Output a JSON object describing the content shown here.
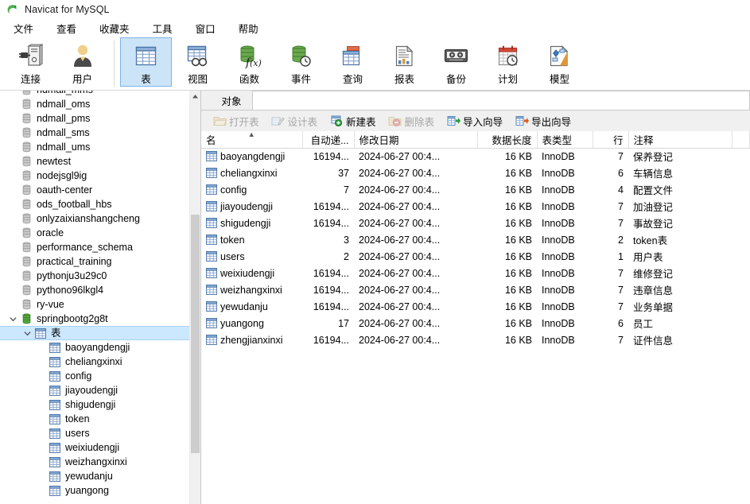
{
  "window": {
    "title": "Navicat for MySQL",
    "logo_icon": "navicat-logo-icon"
  },
  "menubar": {
    "items": [
      {
        "label": "文件",
        "name": "menu-file"
      },
      {
        "label": "查看",
        "name": "menu-view"
      },
      {
        "label": "收藏夹",
        "name": "menu-favorites"
      },
      {
        "label": "工具",
        "name": "menu-tools"
      },
      {
        "label": "窗口",
        "name": "menu-window"
      },
      {
        "label": "帮助",
        "name": "menu-help"
      }
    ]
  },
  "toolbar": {
    "buttons": [
      {
        "label": "连接",
        "icon": "connection-icon",
        "selected": false
      },
      {
        "label": "用户",
        "icon": "user-icon",
        "selected": false
      },
      {
        "label": "表",
        "icon": "table-icon",
        "selected": true
      },
      {
        "label": "视图",
        "icon": "view-icon",
        "selected": false
      },
      {
        "label": "函数",
        "icon": "function-icon",
        "selected": false
      },
      {
        "label": "事件",
        "icon": "event-icon",
        "selected": false
      },
      {
        "label": "查询",
        "icon": "query-icon",
        "selected": false
      },
      {
        "label": "报表",
        "icon": "report-icon",
        "selected": false
      },
      {
        "label": "备份",
        "icon": "backup-icon",
        "selected": false
      },
      {
        "label": "计划",
        "icon": "schedule-icon",
        "selected": false
      },
      {
        "label": "模型",
        "icon": "model-icon",
        "selected": false
      }
    ]
  },
  "sidebar": {
    "nodes": [
      {
        "label": "ndmall_mms",
        "icon": "database-icon",
        "indent": 1,
        "twist": "",
        "selected": false
      },
      {
        "label": "ndmall_oms",
        "icon": "database-icon",
        "indent": 1,
        "twist": "",
        "selected": false
      },
      {
        "label": "ndmall_pms",
        "icon": "database-icon",
        "indent": 1,
        "twist": "",
        "selected": false
      },
      {
        "label": "ndmall_sms",
        "icon": "database-icon",
        "indent": 1,
        "twist": "",
        "selected": false
      },
      {
        "label": "ndmall_ums",
        "icon": "database-icon",
        "indent": 1,
        "twist": "",
        "selected": false
      },
      {
        "label": "newtest",
        "icon": "database-icon",
        "indent": 1,
        "twist": "",
        "selected": false
      },
      {
        "label": "nodejsgl9ig",
        "icon": "database-icon",
        "indent": 1,
        "twist": "",
        "selected": false
      },
      {
        "label": "oauth-center",
        "icon": "database-icon",
        "indent": 1,
        "twist": "",
        "selected": false
      },
      {
        "label": "ods_football_hbs",
        "icon": "database-icon",
        "indent": 1,
        "twist": "",
        "selected": false
      },
      {
        "label": "onlyzaixianshangcheng",
        "icon": "database-icon",
        "indent": 1,
        "twist": "",
        "selected": false
      },
      {
        "label": "oracle",
        "icon": "database-icon",
        "indent": 1,
        "twist": "",
        "selected": false
      },
      {
        "label": "performance_schema",
        "icon": "database-icon",
        "indent": 1,
        "twist": "",
        "selected": false
      },
      {
        "label": "practical_training",
        "icon": "database-icon",
        "indent": 1,
        "twist": "",
        "selected": false
      },
      {
        "label": "pythonju3u29c0",
        "icon": "database-icon",
        "indent": 1,
        "twist": "",
        "selected": false
      },
      {
        "label": "pythono96lkgl4",
        "icon": "database-icon",
        "indent": 1,
        "twist": "",
        "selected": false
      },
      {
        "label": "ry-vue",
        "icon": "database-icon",
        "indent": 1,
        "twist": "",
        "selected": false
      },
      {
        "label": "springbootg2g8t",
        "icon": "database-open-icon",
        "indent": 1,
        "twist": "expanded",
        "selected": false
      },
      {
        "label": "表",
        "icon": "table-folder-icon",
        "indent": 2,
        "twist": "expanded",
        "selected": true
      },
      {
        "label": "baoyangdengji",
        "icon": "table-item-icon",
        "indent": 3,
        "twist": "",
        "selected": false
      },
      {
        "label": "cheliangxinxi",
        "icon": "table-item-icon",
        "indent": 3,
        "twist": "",
        "selected": false
      },
      {
        "label": "config",
        "icon": "table-item-icon",
        "indent": 3,
        "twist": "",
        "selected": false
      },
      {
        "label": "jiayoudengji",
        "icon": "table-item-icon",
        "indent": 3,
        "twist": "",
        "selected": false
      },
      {
        "label": "shigudengji",
        "icon": "table-item-icon",
        "indent": 3,
        "twist": "",
        "selected": false
      },
      {
        "label": "token",
        "icon": "table-item-icon",
        "indent": 3,
        "twist": "",
        "selected": false
      },
      {
        "label": "users",
        "icon": "table-item-icon",
        "indent": 3,
        "twist": "",
        "selected": false
      },
      {
        "label": "weixiudengji",
        "icon": "table-item-icon",
        "indent": 3,
        "twist": "",
        "selected": false
      },
      {
        "label": "weizhangxinxi",
        "icon": "table-item-icon",
        "indent": 3,
        "twist": "",
        "selected": false
      },
      {
        "label": "yewudanju",
        "icon": "table-item-icon",
        "indent": 3,
        "twist": "",
        "selected": false
      },
      {
        "label": "yuangong",
        "icon": "table-item-icon",
        "indent": 3,
        "twist": "",
        "selected": false
      }
    ]
  },
  "tabs": {
    "items": [
      {
        "label": "对象",
        "active": true
      }
    ]
  },
  "objectbar": {
    "buttons": [
      {
        "label": "打开表",
        "icon": "open-table-icon",
        "disabled": true
      },
      {
        "label": "设计表",
        "icon": "design-table-icon",
        "disabled": true
      },
      {
        "label": "新建表",
        "icon": "new-table-icon",
        "disabled": false
      },
      {
        "label": "删除表",
        "icon": "delete-table-icon",
        "disabled": true
      },
      {
        "label": "导入向导",
        "icon": "import-wizard-icon",
        "disabled": false
      },
      {
        "label": "导出向导",
        "icon": "export-wizard-icon",
        "disabled": false
      }
    ]
  },
  "grid": {
    "columns": [
      {
        "key": "name",
        "label": "名",
        "align": "left",
        "sorted": true
      },
      {
        "key": "autoinc",
        "label": "自动递...",
        "align": "right",
        "sorted": false
      },
      {
        "key": "modified",
        "label": "修改日期",
        "align": "left",
        "sorted": false
      },
      {
        "key": "length",
        "label": "数据长度",
        "align": "right",
        "sorted": false
      },
      {
        "key": "engine",
        "label": "表类型",
        "align": "left",
        "sorted": false
      },
      {
        "key": "rows",
        "label": "行",
        "align": "right",
        "sorted": false
      },
      {
        "key": "comment",
        "label": "注释",
        "align": "left",
        "sorted": false
      }
    ],
    "rows": [
      {
        "name": "baoyangdengji",
        "autoinc": "16194...",
        "modified": "2024-06-27 00:4...",
        "length": "16 KB",
        "engine": "InnoDB",
        "rows": "7",
        "comment": "保养登记"
      },
      {
        "name": "cheliangxinxi",
        "autoinc": "37",
        "modified": "2024-06-27 00:4...",
        "length": "16 KB",
        "engine": "InnoDB",
        "rows": "6",
        "comment": "车辆信息"
      },
      {
        "name": "config",
        "autoinc": "7",
        "modified": "2024-06-27 00:4...",
        "length": "16 KB",
        "engine": "InnoDB",
        "rows": "4",
        "comment": "配置文件"
      },
      {
        "name": "jiayoudengji",
        "autoinc": "16194...",
        "modified": "2024-06-27 00:4...",
        "length": "16 KB",
        "engine": "InnoDB",
        "rows": "7",
        "comment": "加油登记"
      },
      {
        "name": "shigudengji",
        "autoinc": "16194...",
        "modified": "2024-06-27 00:4...",
        "length": "16 KB",
        "engine": "InnoDB",
        "rows": "7",
        "comment": "事故登记"
      },
      {
        "name": "token",
        "autoinc": "3",
        "modified": "2024-06-27 00:4...",
        "length": "16 KB",
        "engine": "InnoDB",
        "rows": "2",
        "comment": "token表"
      },
      {
        "name": "users",
        "autoinc": "2",
        "modified": "2024-06-27 00:4...",
        "length": "16 KB",
        "engine": "InnoDB",
        "rows": "1",
        "comment": "用户表"
      },
      {
        "name": "weixiudengji",
        "autoinc": "16194...",
        "modified": "2024-06-27 00:4...",
        "length": "16 KB",
        "engine": "InnoDB",
        "rows": "7",
        "comment": "维修登记"
      },
      {
        "name": "weizhangxinxi",
        "autoinc": "16194...",
        "modified": "2024-06-27 00:4...",
        "length": "16 KB",
        "engine": "InnoDB",
        "rows": "7",
        "comment": "违章信息"
      },
      {
        "name": "yewudanju",
        "autoinc": "16194...",
        "modified": "2024-06-27 00:4...",
        "length": "16 KB",
        "engine": "InnoDB",
        "rows": "7",
        "comment": "业务单据"
      },
      {
        "name": "yuangong",
        "autoinc": "17",
        "modified": "2024-06-27 00:4...",
        "length": "16 KB",
        "engine": "InnoDB",
        "rows": "6",
        "comment": "员工"
      },
      {
        "name": "zhengjianxinxi",
        "autoinc": "16194...",
        "modified": "2024-06-27 00:4...",
        "length": "16 KB",
        "engine": "InnoDB",
        "rows": "7",
        "comment": "证件信息"
      }
    ]
  },
  "colors": {
    "selection": "#cce8ff",
    "toolbar_selected": "#cce4f7",
    "accent_green": "#4e9a3e",
    "chrome_gray": "#f0f0f0"
  }
}
